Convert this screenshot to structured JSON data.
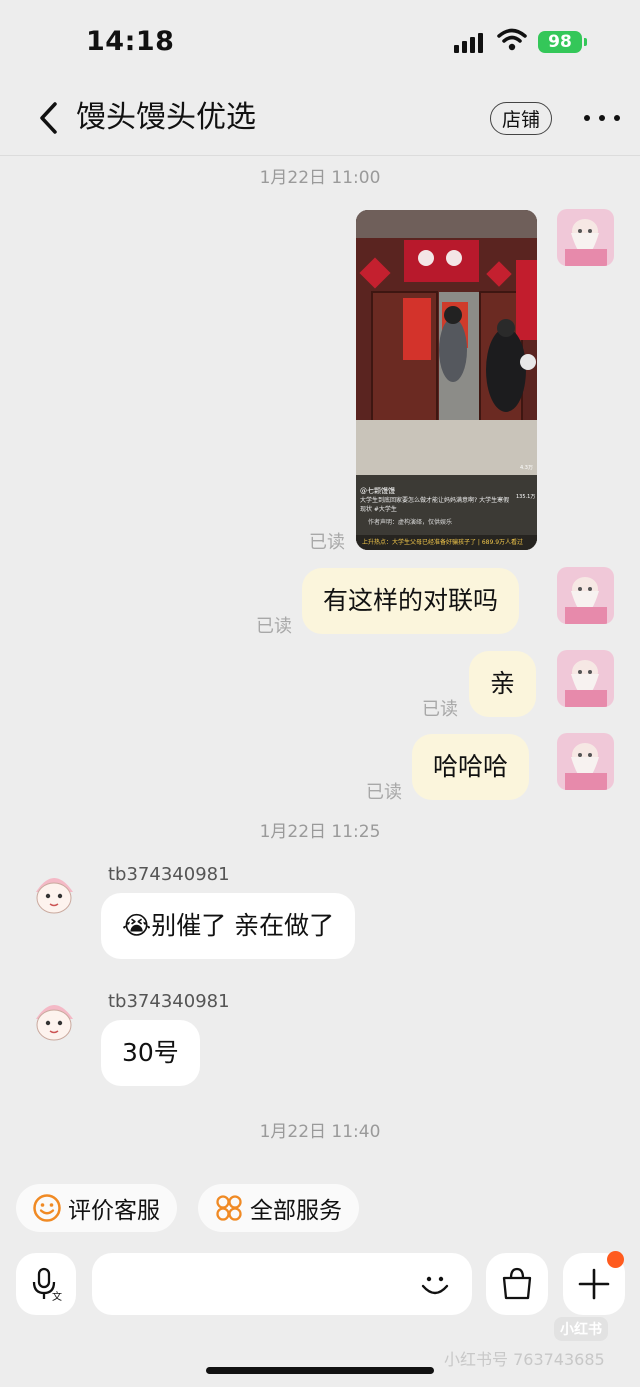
{
  "status_bar": {
    "time": "14:18",
    "battery": "98"
  },
  "nav": {
    "title": "馒头馒头优选",
    "store_label": "店铺"
  },
  "messages": {
    "ts1": "1月22日 11:00",
    "read1": "已读",
    "msg1": "有这样的对联吗",
    "read2": "已读",
    "msg2": "亲",
    "read3": "已读",
    "msg3": "哈哈哈",
    "read4": "已读",
    "ts2": "1月22日 11:25",
    "sender1": "tb374340981",
    "reply1": "😭别催了 亲在做了",
    "sender2": "tb374340981",
    "reply2": "30号",
    "ts3": "1月22日 11:40"
  },
  "video_preview": {
    "account": "@七颗馒馒",
    "caption": "大学生到底回家要怎么做才能让妈妈满意啊? 大学生寒假现状 #大学生",
    "disclaimer": "作者声明：虚构演绎，仅供娱乐",
    "hot_bar": "上升热点：大学生父母已经准备好骗孩子了 | 689.9万人看过",
    "counts": {
      "likes": "4.3万",
      "shares": "135.1万"
    }
  },
  "quick_actions": {
    "rate_service": "评价客服",
    "all_services": "全部服务"
  },
  "input": {
    "placeholder": ""
  },
  "watermark": {
    "logo": "小红书",
    "id": "小红书号 763743685"
  },
  "colors": {
    "my_bubble": "#fbf5dc",
    "accent": "#ff5b1e",
    "battery": "#34c759",
    "icon_orange": "#f08a24"
  }
}
